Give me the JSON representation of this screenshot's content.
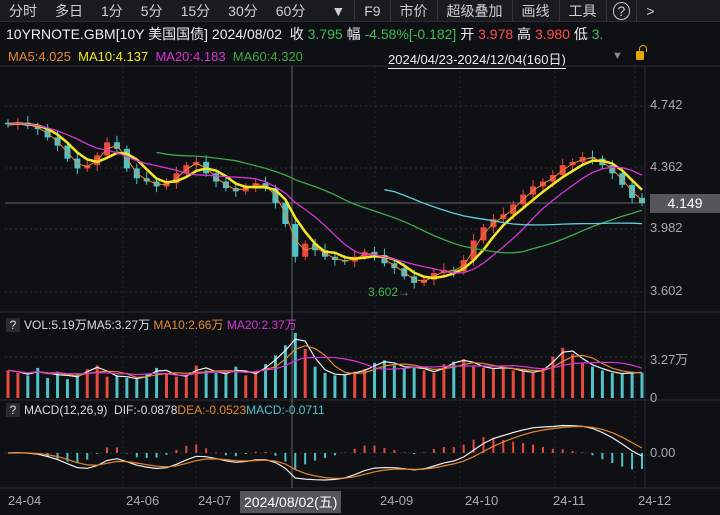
{
  "toolbar": {
    "items": [
      "分时",
      "多日",
      "1分",
      "5分",
      "15分",
      "30分",
      "60分"
    ],
    "dropdown": "▼",
    "right": [
      "F9",
      "市价",
      "超级叠加",
      "画线",
      "工具"
    ],
    "help": "?",
    "more": ">"
  },
  "info": {
    "symbol": "10YRNOTE.GBM[10Y 美国国债]",
    "date": "2024/08/02",
    "close_label": "收",
    "close": "3.795",
    "chg_label": "幅",
    "chg": "-4.58%[-0.182]",
    "open_label": "开",
    "open": "3.978",
    "high_label": "高",
    "high": "3.980",
    "low_label": "低",
    "low": "3."
  },
  "ma": {
    "ma5": "MA5:4.025",
    "ma10": "MA10:4.137",
    "ma20": "MA20:4.183",
    "ma60": "MA60:4.320"
  },
  "range": "2024/04/23-2024/12/04(160日)",
  "colors": {
    "up": "#e84a3f",
    "down": "#4fc3c8",
    "ma5": "#e8862e",
    "ma10": "#f5e625",
    "ma20": "#d535d5",
    "ma60": "#3fa84a",
    "bg": "#0f1014"
  },
  "price_axis": [
    "4.742",
    "4.362",
    "3.982",
    "3.602"
  ],
  "current_price": "4.149",
  "low_marker": "3.602→",
  "vol": {
    "help": "?",
    "label": "VOL:5.19万",
    "ma5": "MA5:3.27万",
    "ma10": "MA10:2.66万",
    "ma20": "MA20:2.37万",
    "axis": [
      "3.27万",
      "0"
    ]
  },
  "macd": {
    "help": "?",
    "label": "MACD(12,26,9)",
    "dif": "DIF:-0.0878",
    "dea": "DEA:-0.0523",
    "macd": "MACD:-0.0711",
    "axis": "0.00"
  },
  "x_axis": [
    "24-04",
    "24-06",
    "24-07",
    "24-09",
    "24-10",
    "24-11",
    "24-12"
  ],
  "crosshair_date": "2024/08/02(五)",
  "chart_data": {
    "type": "candlestick",
    "ylim": [
      3.55,
      4.8
    ],
    "closes": [
      4.63,
      4.64,
      4.62,
      4.6,
      4.55,
      4.5,
      4.42,
      4.36,
      4.38,
      4.44,
      4.52,
      4.48,
      4.36,
      4.3,
      4.28,
      4.25,
      4.27,
      4.33,
      4.38,
      4.4,
      4.33,
      4.28,
      4.24,
      4.22,
      4.25,
      4.27,
      4.24,
      4.15,
      4.02,
      3.82,
      3.9,
      3.86,
      3.82,
      3.8,
      3.79,
      3.82,
      3.85,
      3.83,
      3.78,
      3.75,
      3.7,
      3.66,
      3.68,
      3.72,
      3.74,
      3.73,
      3.8,
      3.92,
      4.0,
      4.05,
      4.08,
      4.14,
      4.2,
      4.25,
      4.28,
      4.32,
      4.38,
      4.4,
      4.43,
      4.42,
      4.38,
      4.33,
      4.26,
      4.18,
      4.149
    ],
    "volumes_wan": [
      2.2,
      2.0,
      1.8,
      2.4,
      1.6,
      2.1,
      1.5,
      1.9,
      2.3,
      2.6,
      1.7,
      1.8,
      1.6,
      1.5,
      1.9,
      2.4,
      2.0,
      1.7,
      1.8,
      2.6,
      2.2,
      2.0,
      1.9,
      2.5,
      1.8,
      2.1,
      2.7,
      3.4,
      4.2,
      5.19,
      3.9,
      2.5,
      2.0,
      1.8,
      1.9,
      2.1,
      2.3,
      2.8,
      3.0,
      2.6,
      2.4,
      2.5,
      2.2,
      2.0,
      2.7,
      2.9,
      3.1,
      2.6,
      2.4,
      2.3,
      2.5,
      2.2,
      2.1,
      2.0,
      2.4,
      3.3,
      4.0,
      3.5,
      2.8,
      2.5,
      2.2,
      2.0,
      1.9,
      2.1,
      2.0
    ]
  }
}
